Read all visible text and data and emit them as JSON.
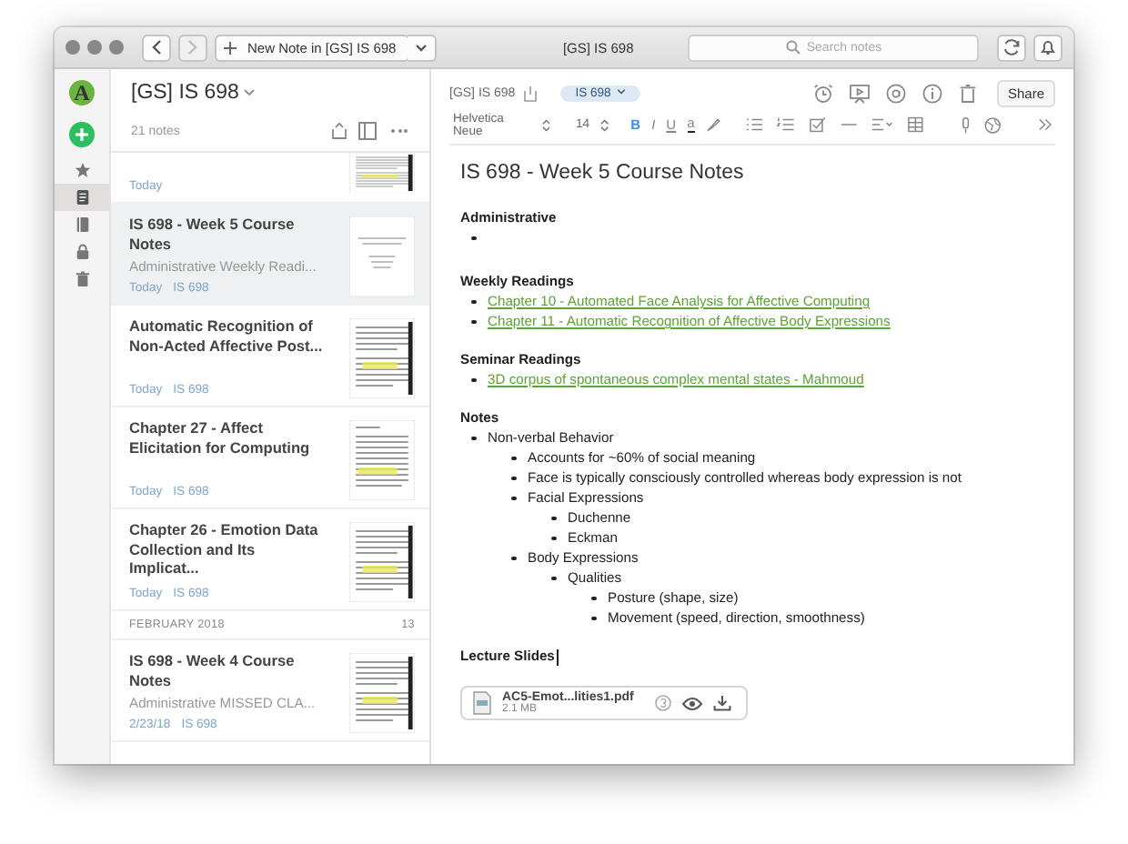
{
  "window": {
    "title": "[GS] IS 698"
  },
  "toolbar": {
    "new_note": "New Note in [GS] IS 698",
    "search": {
      "placeholder": "Search notes"
    }
  },
  "sidebar": {
    "avatar": "A",
    "items": [
      {
        "kind": "star",
        "selected": false
      },
      {
        "kind": "notes",
        "selected": true
      },
      {
        "kind": "notebook",
        "selected": false
      },
      {
        "kind": "lock",
        "selected": false
      },
      {
        "kind": "trash",
        "selected": false
      }
    ]
  },
  "notebook": {
    "title": "[GS] IS 698",
    "count": "21 notes"
  },
  "notes": [
    {
      "kind": "note",
      "date": "Today",
      "selected": false,
      "partial": true
    },
    {
      "kind": "note",
      "title": "IS 698 - Week 5 Course Notes",
      "snippet": "Administrative Weekly Readi...",
      "date": "Today",
      "tag": "IS 698",
      "selected": true
    },
    {
      "kind": "note",
      "title": "Automatic Recognition of Non-Acted Affective Post...",
      "date": "Today",
      "tag": "IS 698",
      "selected": false
    },
    {
      "kind": "note",
      "title": "Chapter 27 - Affect Elicitation for Computing",
      "date": "Today",
      "tag": "IS 698",
      "selected": false
    },
    {
      "kind": "note",
      "title": "Chapter 26 - Emotion Data Collection and Its Implicat...",
      "date": "Today",
      "tag": "IS 698",
      "selected": false
    },
    {
      "kind": "section",
      "label": "FEBRUARY 2018",
      "count": "13"
    },
    {
      "kind": "note",
      "title": "IS 698 - Week 4 Course Notes",
      "snippet": "Administrative MISSED CLA...",
      "date": "2/23/18",
      "tag": "IS 698",
      "selected": false
    }
  ],
  "editor": {
    "notebook": "[GS] IS 698",
    "tag": "IS 698",
    "share": "Share",
    "font": "Helvetica Neue",
    "size": "14",
    "format": [
      {
        "label": "B",
        "selected": true
      },
      {
        "label": "I",
        "selected": false
      },
      {
        "label": "U",
        "selected": false
      },
      {
        "label": "a",
        "selected": false
      }
    ],
    "title": "IS 698 - Week 5 Course Notes",
    "sections": [
      {
        "heading": "Administrative",
        "items": [
          {
            "kind": "empty"
          }
        ]
      },
      {
        "heading": "Weekly Readings",
        "items": [
          {
            "kind": "link",
            "text": "Chapter 10 - Automated Face Analysis for Affective Computing"
          },
          {
            "kind": "link",
            "text": "Chapter 11 - Automatic Recognition of Affective Body Expressions"
          }
        ]
      },
      {
        "heading": "Seminar Readings",
        "items": [
          {
            "kind": "link",
            "text": "3D corpus of spontaneous complex mental states - Mahmoud"
          }
        ]
      },
      {
        "heading": "Notes",
        "items": [
          {
            "kind": "text",
            "text": "Non-verbal Behavior",
            "children": [
              {
                "kind": "text",
                "text": "Accounts for ~60% of social meaning"
              },
              {
                "kind": "text",
                "text": "Face is typically consciously controlled whereas body expression is not"
              },
              {
                "kind": "text",
                "text": "Facial Expressions",
                "children": [
                  {
                    "kind": "text",
                    "text": "Duchenne"
                  },
                  {
                    "kind": "text",
                    "text": "Eckman"
                  }
                ]
              },
              {
                "kind": "text",
                "text": "Body Expressions",
                "children": [
                  {
                    "kind": "text",
                    "text": "Qualities",
                    "children": [
                      {
                        "kind": "text",
                        "text": "Posture (shape, size)"
                      },
                      {
                        "kind": "text",
                        "text": "Movement (speed, direction, smoothness)"
                      }
                    ]
                  }
                ]
              }
            ]
          }
        ]
      },
      {
        "heading": "Lecture Slides"
      }
    ],
    "attachment": {
      "name": "AC5-Emot...lities1.pdf",
      "size": "2.1 MB"
    }
  }
}
